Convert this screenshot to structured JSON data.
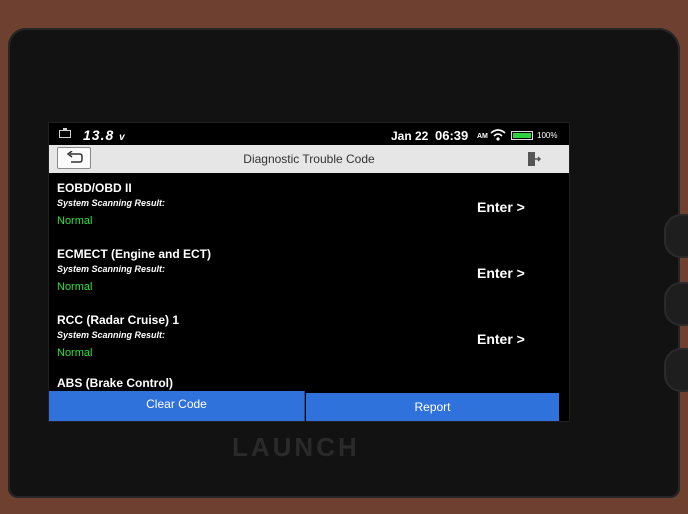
{
  "status_bar": {
    "voltage": "13.8",
    "voltage_unit": "v",
    "date": "Jan 22",
    "time": "06:39",
    "ampm": "AM",
    "battery_percent": "100%"
  },
  "header": {
    "title": "Diagnostic Trouble Code"
  },
  "systems": [
    {
      "name": "EOBD/OBD II",
      "result_label": "System Scanning Result:",
      "result": "Normal",
      "action": "Enter >"
    },
    {
      "name": "ECMECT (Engine and ECT)",
      "result_label": "System Scanning Result:",
      "result": "Normal",
      "action": "Enter >"
    },
    {
      "name": "RCC (Radar Cruise) 1",
      "result_label": "System Scanning Result:",
      "result": "Normal",
      "action": "Enter >"
    }
  ],
  "partial_item": "ABS (Brake Control)",
  "footer": {
    "clear_code": "Clear Code",
    "report": "Report"
  },
  "device": {
    "brand": "LAUNCH"
  },
  "colors": {
    "accent_blue": "#2f72dc",
    "status_green": "#30e040",
    "header_bg": "#e6e6e6"
  }
}
